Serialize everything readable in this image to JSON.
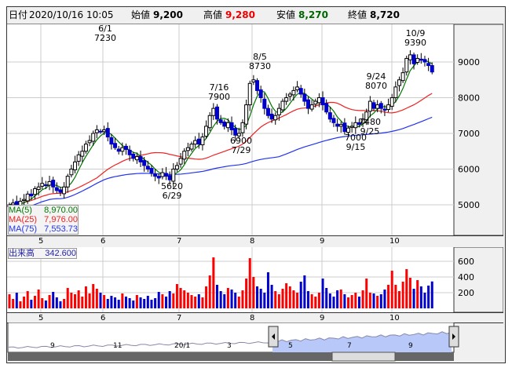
{
  "header": {
    "date_label": "日付",
    "date": "2020/10/16 10:05",
    "open_label": "始値",
    "open": "9,200",
    "high_label": "高値",
    "high": "9,280",
    "low_label": "安値",
    "low": "8,270",
    "close_label": "終値",
    "close": "8,720"
  },
  "colors": {
    "up": "#ff0000",
    "down": "#0000cc",
    "ma5": "#007700",
    "ma25": "#ee2222",
    "ma75": "#2233ee",
    "nav_fill": "#b8c8f8"
  },
  "legend": [
    {
      "label": "MA(5)",
      "value": "8,970.00"
    },
    {
      "label": "MA(25)",
      "value": "7,976.00"
    },
    {
      "label": "MA(75)",
      "value": "7,553.73"
    }
  ],
  "volume_legend": {
    "label": "出来高",
    "value": "342.600"
  },
  "price_axis": [
    "9000",
    "8000",
    "7000",
    "6000",
    "5000"
  ],
  "volume_axis": [
    "600",
    "400",
    "200"
  ],
  "months": [
    "5",
    "6",
    "7",
    "8",
    "9",
    "10"
  ],
  "nav_labels": [
    "9",
    "11",
    "20/1",
    "3",
    "5",
    "7",
    "9"
  ],
  "annotations": [
    {
      "date": "6/1",
      "price": "7230"
    },
    {
      "date": "7/16",
      "price": "7900"
    },
    {
      "date": "8/5",
      "price": "8730"
    },
    {
      "date": "10/9",
      "price": "9390"
    },
    {
      "date": "9/24",
      "price": "8070"
    },
    {
      "date": "6/29",
      "price": "5620"
    },
    {
      "date": "7/29",
      "price": "6900"
    },
    {
      "date": "9/15",
      "price": "7000"
    },
    {
      "date": "9/25",
      "price": "7480"
    }
  ],
  "chart_data": {
    "type": "candlestick",
    "ylim": [
      4500,
      10000
    ],
    "closes": [
      5000,
      5050,
      4980,
      5100,
      5150,
      5300,
      5250,
      5450,
      5500,
      5600,
      5550,
      5650,
      5500,
      5400,
      5350,
      5500,
      5800,
      6000,
      6200,
      6400,
      6500,
      6700,
      6800,
      7000,
      7100,
      7050,
      7100,
      6900,
      6700,
      6600,
      6500,
      6600,
      6550,
      6400,
      6300,
      6350,
      6200,
      6100,
      6000,
      5900,
      5800,
      5750,
      5900,
      5800,
      5700,
      6000,
      6100,
      6300,
      6500,
      6600,
      6700,
      6800,
      6700,
      6900,
      7200,
      7500,
      7700,
      7400,
      7300,
      7200,
      7300,
      7100,
      6950,
      7000,
      7300,
      7800,
      8400,
      8500,
      8200,
      8000,
      7700,
      7500,
      7400,
      7500,
      7700,
      7900,
      8000,
      8100,
      8200,
      8300,
      8100,
      7900,
      7700,
      7800,
      7900,
      8000,
      7800,
      7600,
      7400,
      7300,
      7200,
      7250,
      7050,
      7150,
      7200,
      7300,
      7250,
      7400,
      7600,
      7900,
      7700,
      7800,
      7700,
      7650,
      7800,
      8000,
      8300,
      8500,
      8700,
      9100,
      9200,
      8950,
      9100,
      9050,
      9000,
      8900,
      8720
    ],
    "volumes": [
      180,
      120,
      200,
      90,
      150,
      220,
      110,
      160,
      240,
      130,
      100,
      170,
      210,
      140,
      90,
      120,
      260,
      200,
      180,
      230,
      150,
      280,
      190,
      310,
      250,
      200,
      170,
      120,
      160,
      140,
      110,
      190,
      150,
      130,
      100,
      170,
      140,
      120,
      160,
      110,
      130,
      210,
      180,
      150,
      220,
      190,
      310,
      260,
      230,
      200,
      170,
      150,
      180,
      140,
      280,
      420,
      650,
      300,
      220,
      180,
      260,
      240,
      200,
      150,
      230,
      380,
      640,
      400,
      280,
      250,
      200,
      460,
      300,
      220,
      180,
      250,
      320,
      280,
      230,
      200,
      340,
      420,
      220,
      180,
      150,
      200,
      380,
      260,
      190,
      150,
      230,
      240,
      180,
      140,
      170,
      200,
      150,
      230,
      380,
      200,
      190,
      160,
      180,
      240,
      300,
      480,
      300,
      220,
      340,
      500,
      390,
      250,
      360,
      280,
      200,
      290,
      343
    ]
  }
}
